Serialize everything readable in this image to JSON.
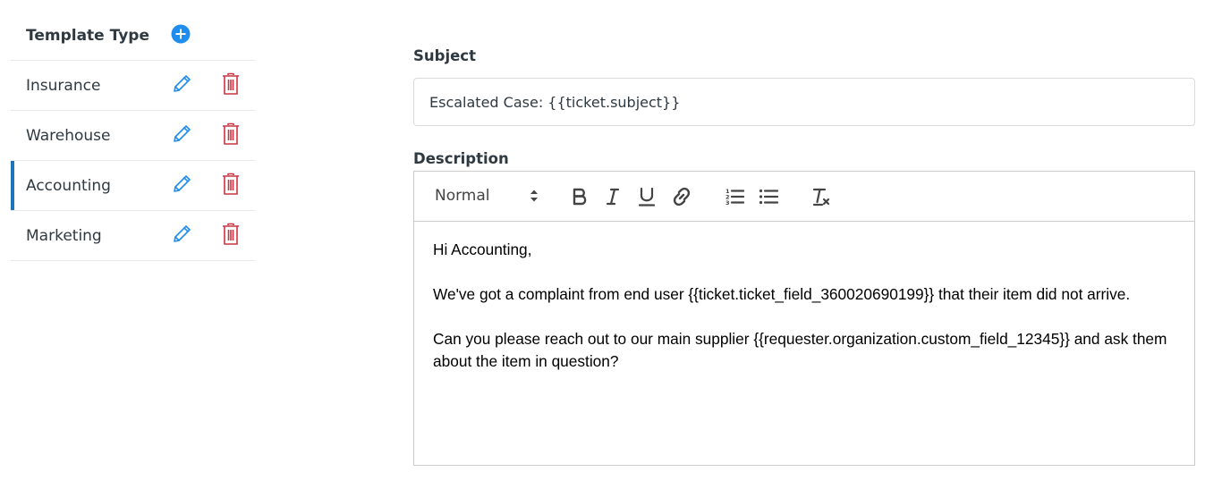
{
  "sidebar": {
    "title": "Template Type",
    "add_icon": "plus-circle-icon",
    "items": [
      {
        "label": "Insurance",
        "active": false
      },
      {
        "label": "Warehouse",
        "active": false
      },
      {
        "label": "Accounting",
        "active": true
      },
      {
        "label": "Marketing",
        "active": false
      }
    ]
  },
  "form": {
    "subject_label": "Subject",
    "subject_value": "Escalated Case: {{ticket.subject}}",
    "description_label": "Description",
    "toolbar": {
      "format_value": "Normal",
      "bold_glyph": "B",
      "italic_glyph": "I",
      "underline_glyph": "U"
    },
    "body": [
      "Hi Accounting,",
      "We've got a complaint from end user {{ticket.ticket_field_360020690199}} that their item did not arrive.",
      "Can you please reach out to our main supplier {{requester.organization.custom_field_12345}} and ask them about the item in question?"
    ]
  },
  "colors": {
    "accent_blue": "#1f73b7",
    "add_blue": "#1f8ded",
    "edit_blue": "#1f8ded",
    "delete_red": "#cc3340",
    "text": "#2f3941",
    "divider": "#e6e9eb"
  }
}
